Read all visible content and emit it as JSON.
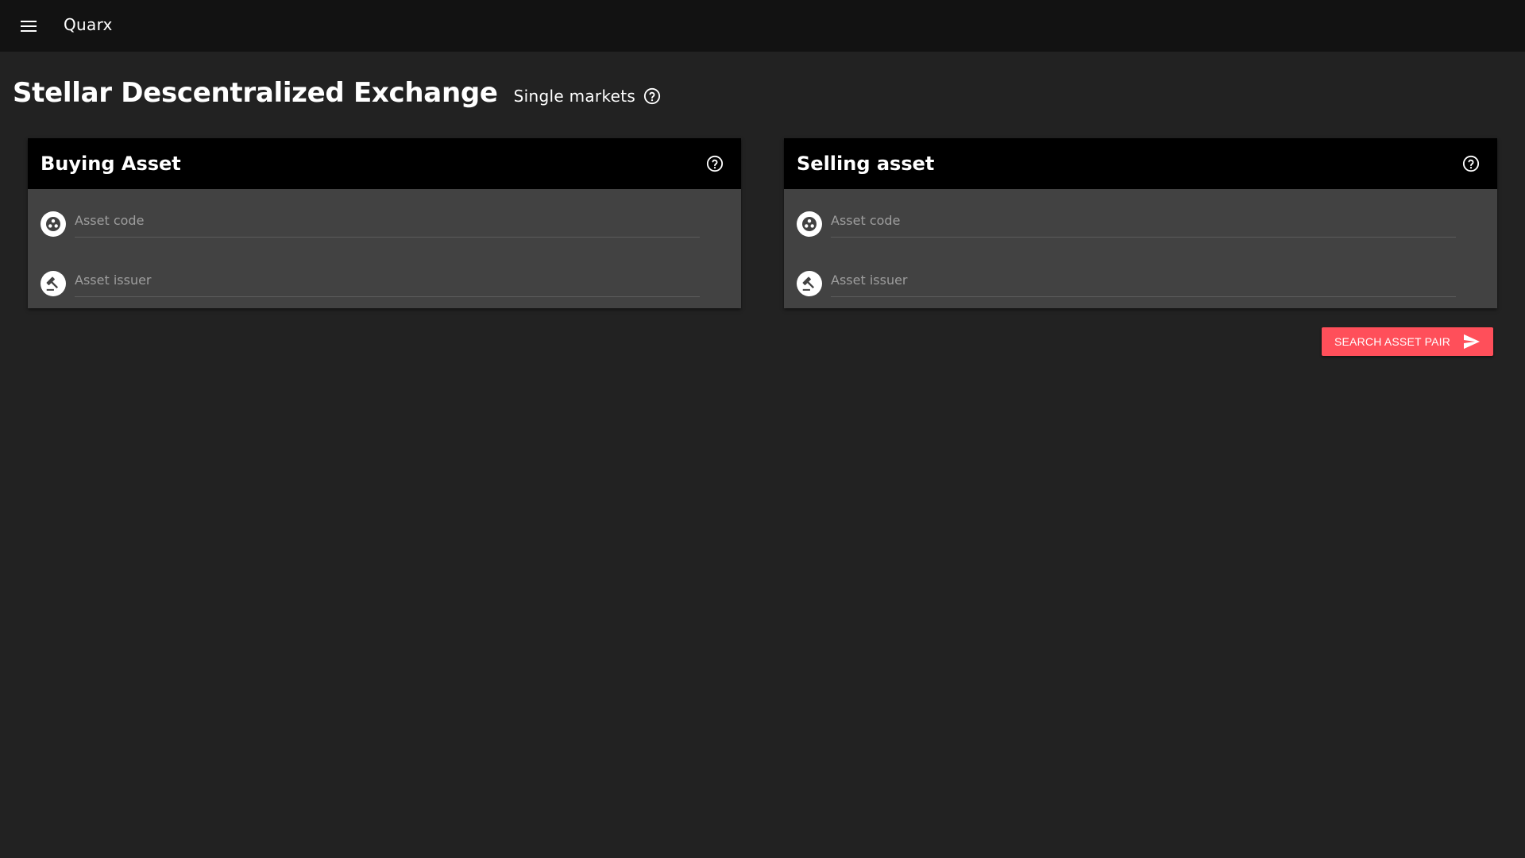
{
  "app": {
    "title": "Quarx",
    "menu_icon": "menu-icon"
  },
  "page": {
    "title": "Stellar Descentralized Exchange",
    "subtitle": "Single markets",
    "help_icon": "help-circle-icon"
  },
  "cards": {
    "buying": {
      "title": "Buying Asset",
      "code_placeholder": "Asset code",
      "issuer_placeholder": "Asset issuer"
    },
    "selling": {
      "title": "Selling asset",
      "code_placeholder": "Asset code",
      "issuer_placeholder": "Asset issuer"
    }
  },
  "actions": {
    "search_label": "SEARCH ASSET PAIR",
    "search_icon": "send-icon"
  },
  "colors": {
    "background": "#222222",
    "topbar": "#121212",
    "card": "#424242",
    "card_header": "#000000",
    "accent": "#ff4f5a"
  }
}
